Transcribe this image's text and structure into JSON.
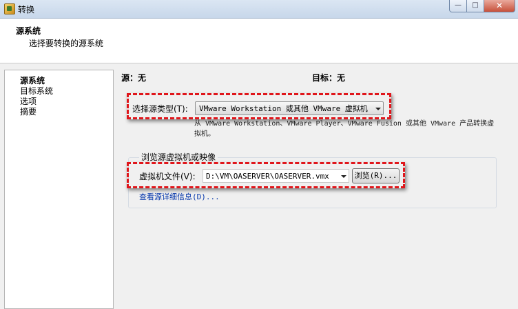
{
  "window": {
    "title": "转换",
    "minimize": "—",
    "maximize": "□",
    "close": "✕"
  },
  "header": {
    "title": "源系统",
    "subtitle": "选择要转换的源系统"
  },
  "nav": {
    "items": [
      "源系统",
      "目标系统",
      "选项",
      "摘要"
    ],
    "active_index": 0
  },
  "main": {
    "source_label": "源：无",
    "target_label": "目标：无",
    "source_type_label": "选择源类型(T):",
    "source_type_value": "VMware Workstation 或其他 VMware 虚拟机",
    "source_type_description": "从 VMware Workstation、VMware Player、VMware Fusion 或其他 VMware 产品转换虚拟机。",
    "browse_group_title": "浏览源虚拟机或映像",
    "vm_file_label": "虚拟机文件(V):",
    "vm_file_value": "D:\\VM\\OASERVER\\OASERVER.vmx",
    "browse_button": "浏览(R)...",
    "details_link": "查看源详细信息(D)..."
  },
  "colors": {
    "highlight": "#e0161b",
    "link": "#0033aa",
    "background": "#f0f0f0"
  }
}
